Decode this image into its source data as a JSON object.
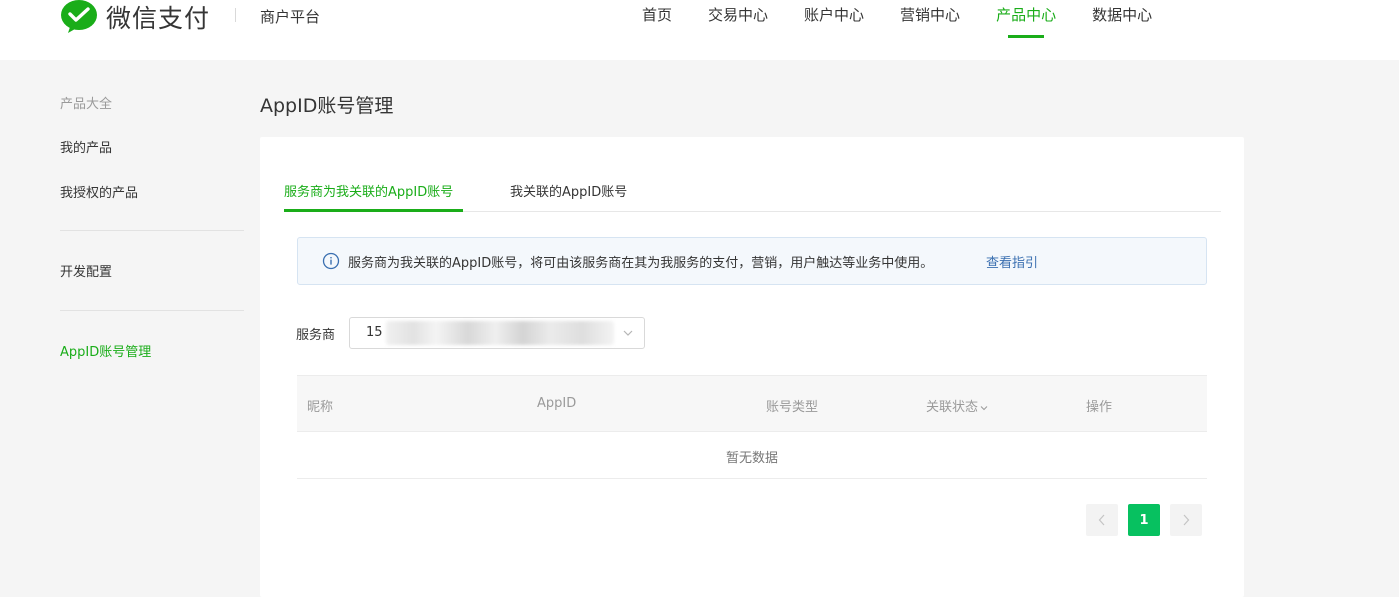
{
  "header": {
    "logo_text": "微信支付",
    "platform": "商户平台",
    "nav": [
      {
        "label": "首页",
        "active": false
      },
      {
        "label": "交易中心",
        "active": false
      },
      {
        "label": "账户中心",
        "active": false
      },
      {
        "label": "营销中心",
        "active": false
      },
      {
        "label": "产品中心",
        "active": true
      },
      {
        "label": "数据中心",
        "active": false
      }
    ]
  },
  "sidebar": {
    "section_title": "产品大全",
    "items": [
      {
        "label": "我的产品",
        "active": false
      },
      {
        "label": "我授权的产品",
        "active": false
      },
      {
        "label": "开发配置",
        "active": false
      },
      {
        "label": "AppID账号管理",
        "active": true
      }
    ]
  },
  "main": {
    "title": "AppID账号管理",
    "tabs": [
      {
        "label": "服务商为我关联的AppID账号",
        "active": true
      },
      {
        "label": "我关联的AppID账号",
        "active": false
      }
    ],
    "notice": {
      "icon": "info-icon",
      "text": "服务商为我关联的AppID账号，将可由该服务商在其为我服务的支付，营销，用户触达等业务中使用。",
      "link": "查看指引"
    },
    "filter": {
      "label": "服务商",
      "value_visible_prefix": "15",
      "icon": "chevron-down-icon"
    },
    "table": {
      "columns": [
        "昵称",
        "AppID",
        "账号类型",
        "关联状态",
        "操作"
      ],
      "empty_text": "暂无数据"
    },
    "pagination": {
      "prev_icon": "chevron-left-icon",
      "current_page": "1",
      "next_icon": "chevron-right-icon"
    }
  },
  "colors": {
    "brand_green": "#1aad19",
    "page_btn_green": "#07c160",
    "link_blue": "#3a6fb0",
    "notice_bg": "#f4f8fc"
  }
}
